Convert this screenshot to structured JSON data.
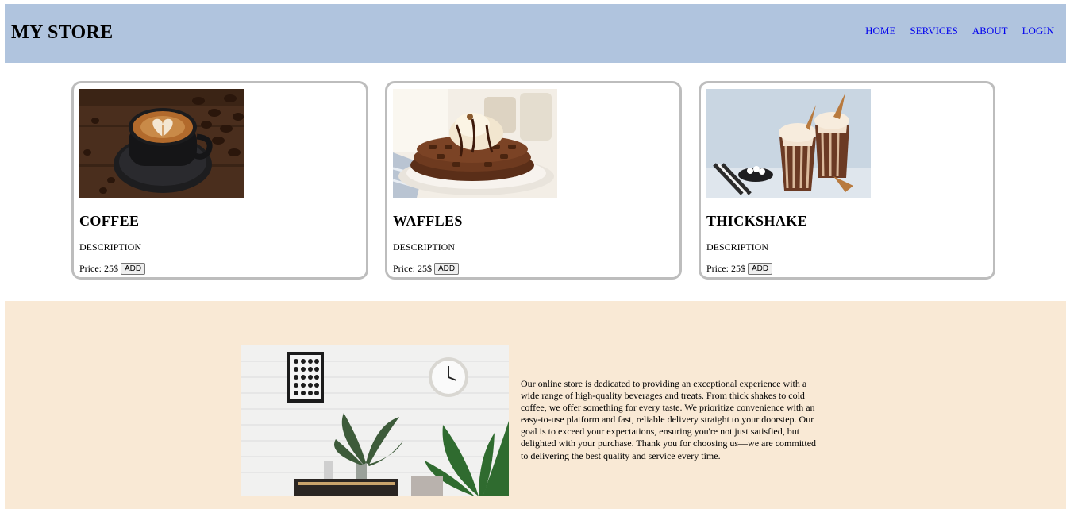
{
  "header": {
    "brand": "MY STORE",
    "nav": [
      "HOME",
      "SERVICES",
      "ABOUT",
      "LOGIN"
    ],
    "background": "#b0c4de",
    "link_color": "#0000ee"
  },
  "products": [
    {
      "name": "COFFEE",
      "description": "DESCRIPTION",
      "price": "Price: 25$",
      "button": "ADD",
      "image": "latte-art-coffee-cup-photo"
    },
    {
      "name": "WAFFLES",
      "description": "DESCRIPTION",
      "price": "Price: 25$",
      "button": "ADD",
      "image": "chocolate-waffles-photo"
    },
    {
      "name": "THICKSHAKE",
      "description": "DESCRIPTION",
      "price": "Price: 25$",
      "button": "ADD",
      "image": "chocolate-thickshakes-photo"
    }
  ],
  "about": {
    "background": "#f9e9d5",
    "image": "interior-wall-clock-plants-photo",
    "text": "Our online store is dedicated to providing an exceptional experience with a wide range of high-quality beverages and treats. From thick shakes to cold coffee, we offer something for every taste. We prioritize convenience with an easy-to-use platform and fast, reliable delivery straight to your doorstep. Our goal is to exceed your expectations, ensuring you're not just satisfied, but delighted with your purchase. Thank you for choosing us—we are committed to delivering the best quality and service every time."
  }
}
